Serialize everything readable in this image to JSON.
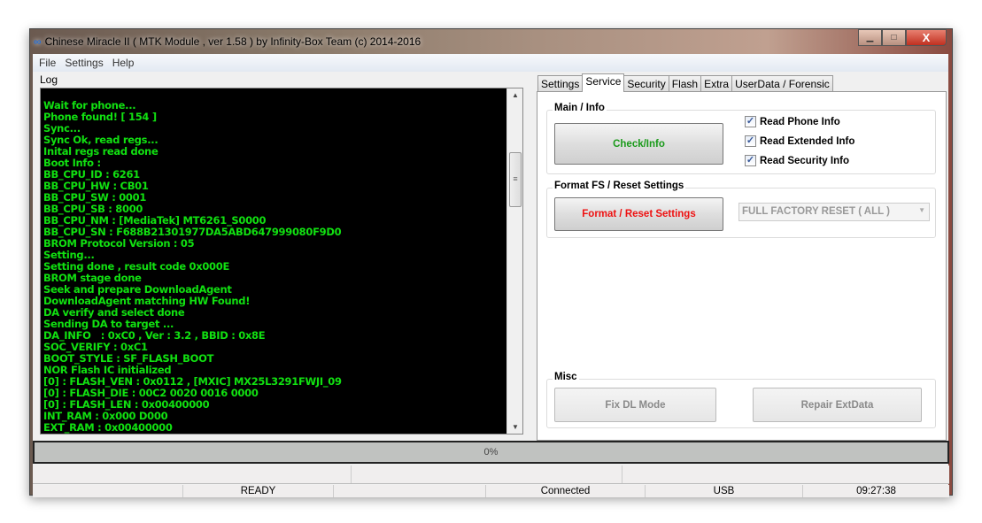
{
  "window": {
    "title": "Chinese Miracle II ( MTK Module , ver 1.58 ) by Infinity-Box Team (c) 2014-2016",
    "minimize": "▁",
    "maximize": "□",
    "close": "X"
  },
  "menu": [
    "File",
    "Settings",
    "Help"
  ],
  "log": {
    "label": "Log",
    "lines": [
      "Wait for phone...",
      "Phone found! [ 154 ]",
      "Sync...",
      "Sync Ok, read regs...",
      "Inital regs read done",
      "Boot Info :",
      "BB_CPU_ID : 6261",
      "BB_CPU_HW : CB01",
      "BB_CPU_SW : 0001",
      "BB_CPU_SB : 8000",
      "BB_CPU_NM : [MediaTek] MT6261_S0000",
      "BB_CPU_SN : F688B21301977DA5ABD647999080F9D0",
      "BROM Protocol Version : 05",
      "Setting...",
      "Setting done , result code 0x000E",
      "BROM stage done",
      "Seek and prepare DownloadAgent",
      "DownloadAgent matching HW Found!",
      "DA verify and select done",
      "Sending DA to target ...",
      "DA_INFO   : 0xC0 , Ver : 3.2 , BBID : 0x8E",
      "SOC_VERIFY : 0xC1",
      "BOOT_STYLE : SF_FLASH_BOOT",
      "NOR Flash IC initialized",
      "[0] : FLASH_VEN : 0x0112 , [MXIC] MX25L3291FWJI_09",
      "[0] : FLASH_DIE : 00C2 0020 0016 0000",
      "[0] : FLASH_LEN : 0x00400000",
      "INT_RAM : 0x000 D000",
      "EXT_RAM : 0x00400000"
    ],
    "text_color": "#11e011"
  },
  "tabs": [
    "Settings",
    "Service",
    "Security",
    "Flash",
    "Extra",
    "UserData / Forensic"
  ],
  "active_tab": "Service",
  "service": {
    "main_info": {
      "title": "Main / Info",
      "check_button": "Check/Info",
      "check_color": "#1a9a1a",
      "options": [
        {
          "label": "Read Phone Info",
          "checked": true
        },
        {
          "label": "Read Extended Info",
          "checked": true
        },
        {
          "label": "Read Security Info",
          "checked": true
        }
      ]
    },
    "format": {
      "title": "Format FS / Reset Settings",
      "button": "Format / Reset Settings",
      "button_color": "#ee1111",
      "select_value": "FULL FACTORY RESET ( ALL )"
    },
    "misc": {
      "title": "Misc",
      "fix_dl": "Fix DL Mode",
      "repair": "Repair ExtData"
    }
  },
  "progress": {
    "text": "0%",
    "value": 0
  },
  "status": {
    "state": "READY",
    "connection": "Connected",
    "port": "USB",
    "time": "09:27:38"
  }
}
